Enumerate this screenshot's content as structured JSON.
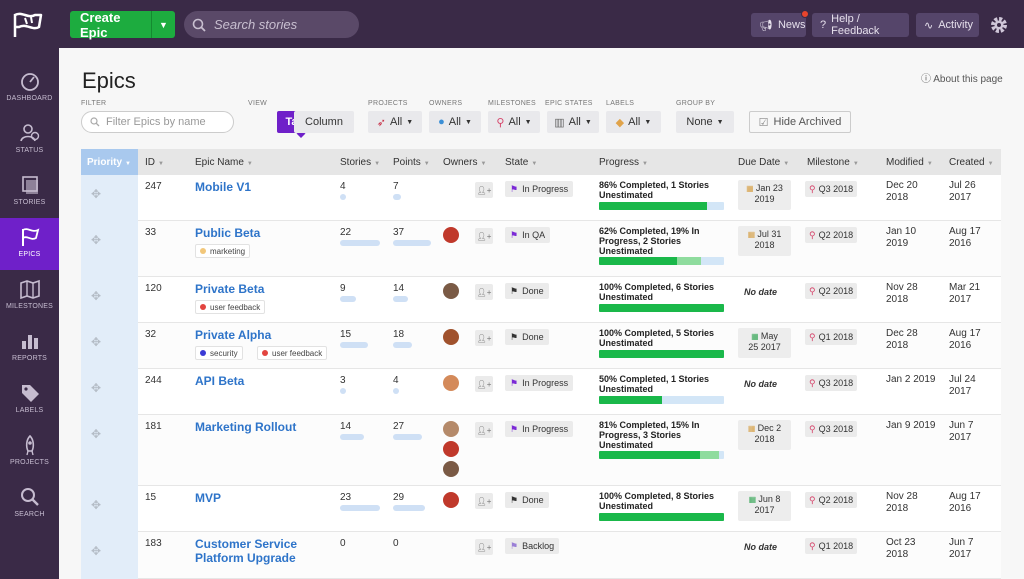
{
  "topbar": {
    "create_label": "Create Epic",
    "search_placeholder": "Search stories",
    "news_label": "News",
    "help_label": "Help / Feedback",
    "activity_label": "Activity"
  },
  "sidebar": {
    "items": [
      {
        "label": "DASHBOARD",
        "icon": "dashboard-icon"
      },
      {
        "label": "STATUS",
        "icon": "status-icon"
      },
      {
        "label": "STORIES",
        "icon": "stories-icon"
      },
      {
        "label": "EPICS",
        "icon": "epics-icon",
        "active": true
      },
      {
        "label": "MILESTONES",
        "icon": "milestones-icon"
      },
      {
        "label": "REPORTS",
        "icon": "reports-icon"
      },
      {
        "label": "LABELS",
        "icon": "labels-icon"
      },
      {
        "label": "PROJECTS",
        "icon": "projects-icon"
      },
      {
        "label": "SEARCH",
        "icon": "search-icon"
      }
    ]
  },
  "page": {
    "title": "Epics",
    "about": "About this page"
  },
  "filters": {
    "filter_label": "FILTER",
    "filter_placeholder": "Filter Epics by name",
    "view_label": "VIEW",
    "view_table": "Table",
    "view_column": "Column",
    "projects_label": "PROJECTS",
    "projects_value": "All",
    "owners_label": "OWNERS",
    "owners_value": "All",
    "milestones_label": "MILESTONES",
    "milestones_value": "All",
    "epic_states_label": "EPIC STATES",
    "epic_states_value": "All",
    "labels_label": "LABELS",
    "labels_value": "All",
    "group_by_label": "GROUP BY",
    "group_by_value": "None",
    "hide_archived": "Hide Archived"
  },
  "table": {
    "headers": {
      "priority": "Priority",
      "id": "ID",
      "name": "Epic Name",
      "stories": "Stories",
      "points": "Points",
      "owners": "Owners",
      "state": "State",
      "progress": "Progress",
      "due": "Due Date",
      "milestone": "Milestone",
      "modified": "Modified",
      "created": "Created"
    },
    "rows": [
      {
        "id": "247",
        "name": "Mobile V1",
        "name2": "",
        "tags": [],
        "stories": "4",
        "points": "7",
        "stories_fill": 0.15,
        "points_fill": 0.2,
        "owners": 0,
        "state": "In Progress",
        "state_color": "#7b2ad6",
        "progress1": "86% Completed, 1 Stories",
        "progress2": "Unestimated",
        "progress3": "",
        "pct": 0.86,
        "pct2": 0,
        "due1": "Jan 23",
        "due2": "2019",
        "due_kind": "y",
        "milestone": "Q3 2018",
        "mod1": "Dec 20",
        "mod2": "2018",
        "cre1": "Jul 26",
        "cre2": "2017"
      },
      {
        "id": "33",
        "name": "Public Beta",
        "name2": "",
        "tags": [
          {
            "label": "marketing",
            "color": "#f2c77a"
          }
        ],
        "stories": "22",
        "points": "37",
        "stories_fill": 1,
        "points_fill": 1,
        "owners": 1,
        "state": "In QA",
        "state_color": "#7b2ad6",
        "progress1": "62% Completed, 19% In",
        "progress2": "Progress, 2 Stories",
        "progress3": "Unestimated",
        "pct": 0.62,
        "pct2": 0.19,
        "due1": "Jul 31",
        "due2": "2018",
        "due_kind": "y",
        "milestone": "Q2 2018",
        "mod1": "Jan 10",
        "mod2": "2019",
        "cre1": "Aug 17",
        "cre2": "2016"
      },
      {
        "id": "120",
        "name": "Private Beta",
        "name2": "",
        "tags": [
          {
            "label": "user feedback",
            "color": "#e2443f"
          }
        ],
        "stories": "9",
        "points": "14",
        "stories_fill": 0.4,
        "points_fill": 0.4,
        "owners": 1,
        "state": "Done",
        "state_color": "#333333",
        "progress1": "100% Completed, 6 Stories",
        "progress2": "Unestimated",
        "progress3": "",
        "pct": 1,
        "pct2": 0,
        "due1": "",
        "due2": "",
        "due_kind": "none",
        "milestone": "Q2 2018",
        "mod1": "Nov 28",
        "mod2": "2018",
        "cre1": "Mar 21",
        "cre2": "2017"
      },
      {
        "id": "32",
        "name": "Private Alpha",
        "name2": "",
        "tags": [
          {
            "label": "security",
            "color": "#3a3ad6"
          },
          {
            "label": "user feedback",
            "color": "#e2443f"
          }
        ],
        "stories": "15",
        "points": "18",
        "stories_fill": 0.7,
        "points_fill": 0.5,
        "owners": 1,
        "state": "Done",
        "state_color": "#333333",
        "progress1": "100% Completed, 5 Stories",
        "progress2": "Unestimated",
        "progress3": "",
        "pct": 1,
        "pct2": 0,
        "due1": "May",
        "due2": "25 2017",
        "due_kind": "g",
        "milestone": "Q1 2018",
        "mod1": "Dec 28",
        "mod2": "2018",
        "cre1": "Aug 17",
        "cre2": "2016"
      },
      {
        "id": "244",
        "name": "API Beta",
        "name2": "",
        "tags": [],
        "stories": "3",
        "points": "4",
        "stories_fill": 0.12,
        "points_fill": 0.12,
        "owners": 1,
        "state": "In Progress",
        "state_color": "#7b2ad6",
        "progress1": "50% Completed, 1 Stories",
        "progress2": "Unestimated",
        "progress3": "",
        "pct": 0.5,
        "pct2": 0,
        "due1": "",
        "due2": "",
        "due_kind": "none",
        "milestone": "Q3 2018",
        "mod1": "Jan 2 2019",
        "mod2": "",
        "cre1": "Jul 24",
        "cre2": "2017"
      },
      {
        "id": "181",
        "name": "Marketing Rollout",
        "name2": "",
        "tags": [],
        "stories": "14",
        "points": "27",
        "stories_fill": 0.6,
        "points_fill": 0.75,
        "owners": 3,
        "state": "In Progress",
        "state_color": "#7b2ad6",
        "progress1": "81% Completed, 15% In",
        "progress2": "Progress, 3 Stories",
        "progress3": "Unestimated",
        "pct": 0.81,
        "pct2": 0.15,
        "due1": "Dec 2",
        "due2": "2018",
        "due_kind": "y",
        "milestone": "Q3 2018",
        "mod1": "Jan 9 2019",
        "mod2": "",
        "cre1": "Jun 7",
        "cre2": "2017"
      },
      {
        "id": "15",
        "name": "MVP",
        "name2": "",
        "tags": [],
        "stories": "23",
        "points": "29",
        "stories_fill": 1,
        "points_fill": 0.85,
        "owners": 1,
        "state": "Done",
        "state_color": "#333333",
        "progress1": "100% Completed, 8 Stories",
        "progress2": "Unestimated",
        "progress3": "",
        "pct": 1,
        "pct2": 0,
        "due1": "Jun 8",
        "due2": "2017",
        "due_kind": "g",
        "milestone": "Q2 2018",
        "mod1": "Nov 28",
        "mod2": "2018",
        "cre1": "Aug 17",
        "cre2": "2016"
      },
      {
        "id": "183",
        "name": "Customer Service",
        "name2": "Platform Upgrade",
        "tags": [],
        "stories": "0",
        "points": "0",
        "stories_fill": 0,
        "points_fill": 0,
        "owners": 0,
        "state": "Backlog",
        "state_color": "#9a7fd6",
        "progress1": "",
        "progress2": "",
        "progress3": "",
        "pct": -1,
        "pct2": 0,
        "due1": "",
        "due2": "",
        "due_kind": "none",
        "milestone": "Q1 2018",
        "mod1": "Oct 23",
        "mod2": "2018",
        "cre1": "Jun 7",
        "cre2": "2017"
      }
    ],
    "no_date": "No date"
  }
}
